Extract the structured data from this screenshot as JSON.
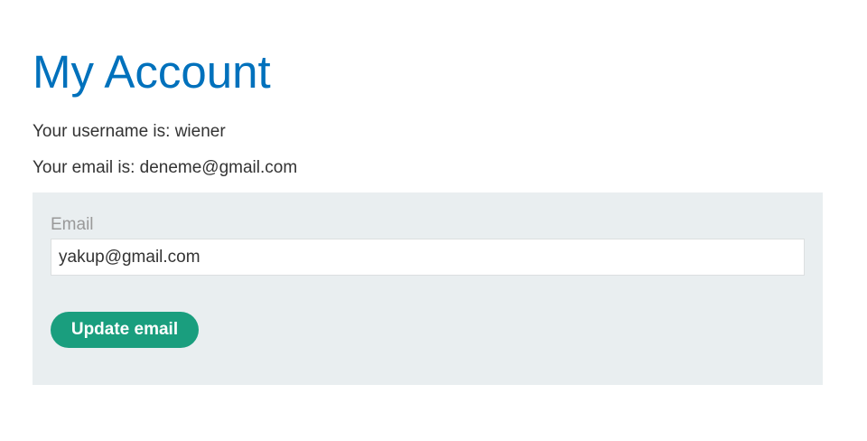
{
  "page": {
    "title": "My Account"
  },
  "account": {
    "username_line": "Your username is: wiener",
    "email_line": "Your email is: deneme@gmail.com"
  },
  "form": {
    "email_label": "Email",
    "email_value": "yakup@gmail.com",
    "submit_label": "Update email"
  },
  "colors": {
    "title": "#0071bc",
    "panel_background": "#e9eef0",
    "button": "#1a9e7e",
    "body_text": "#333333",
    "label_text": "#999999"
  }
}
